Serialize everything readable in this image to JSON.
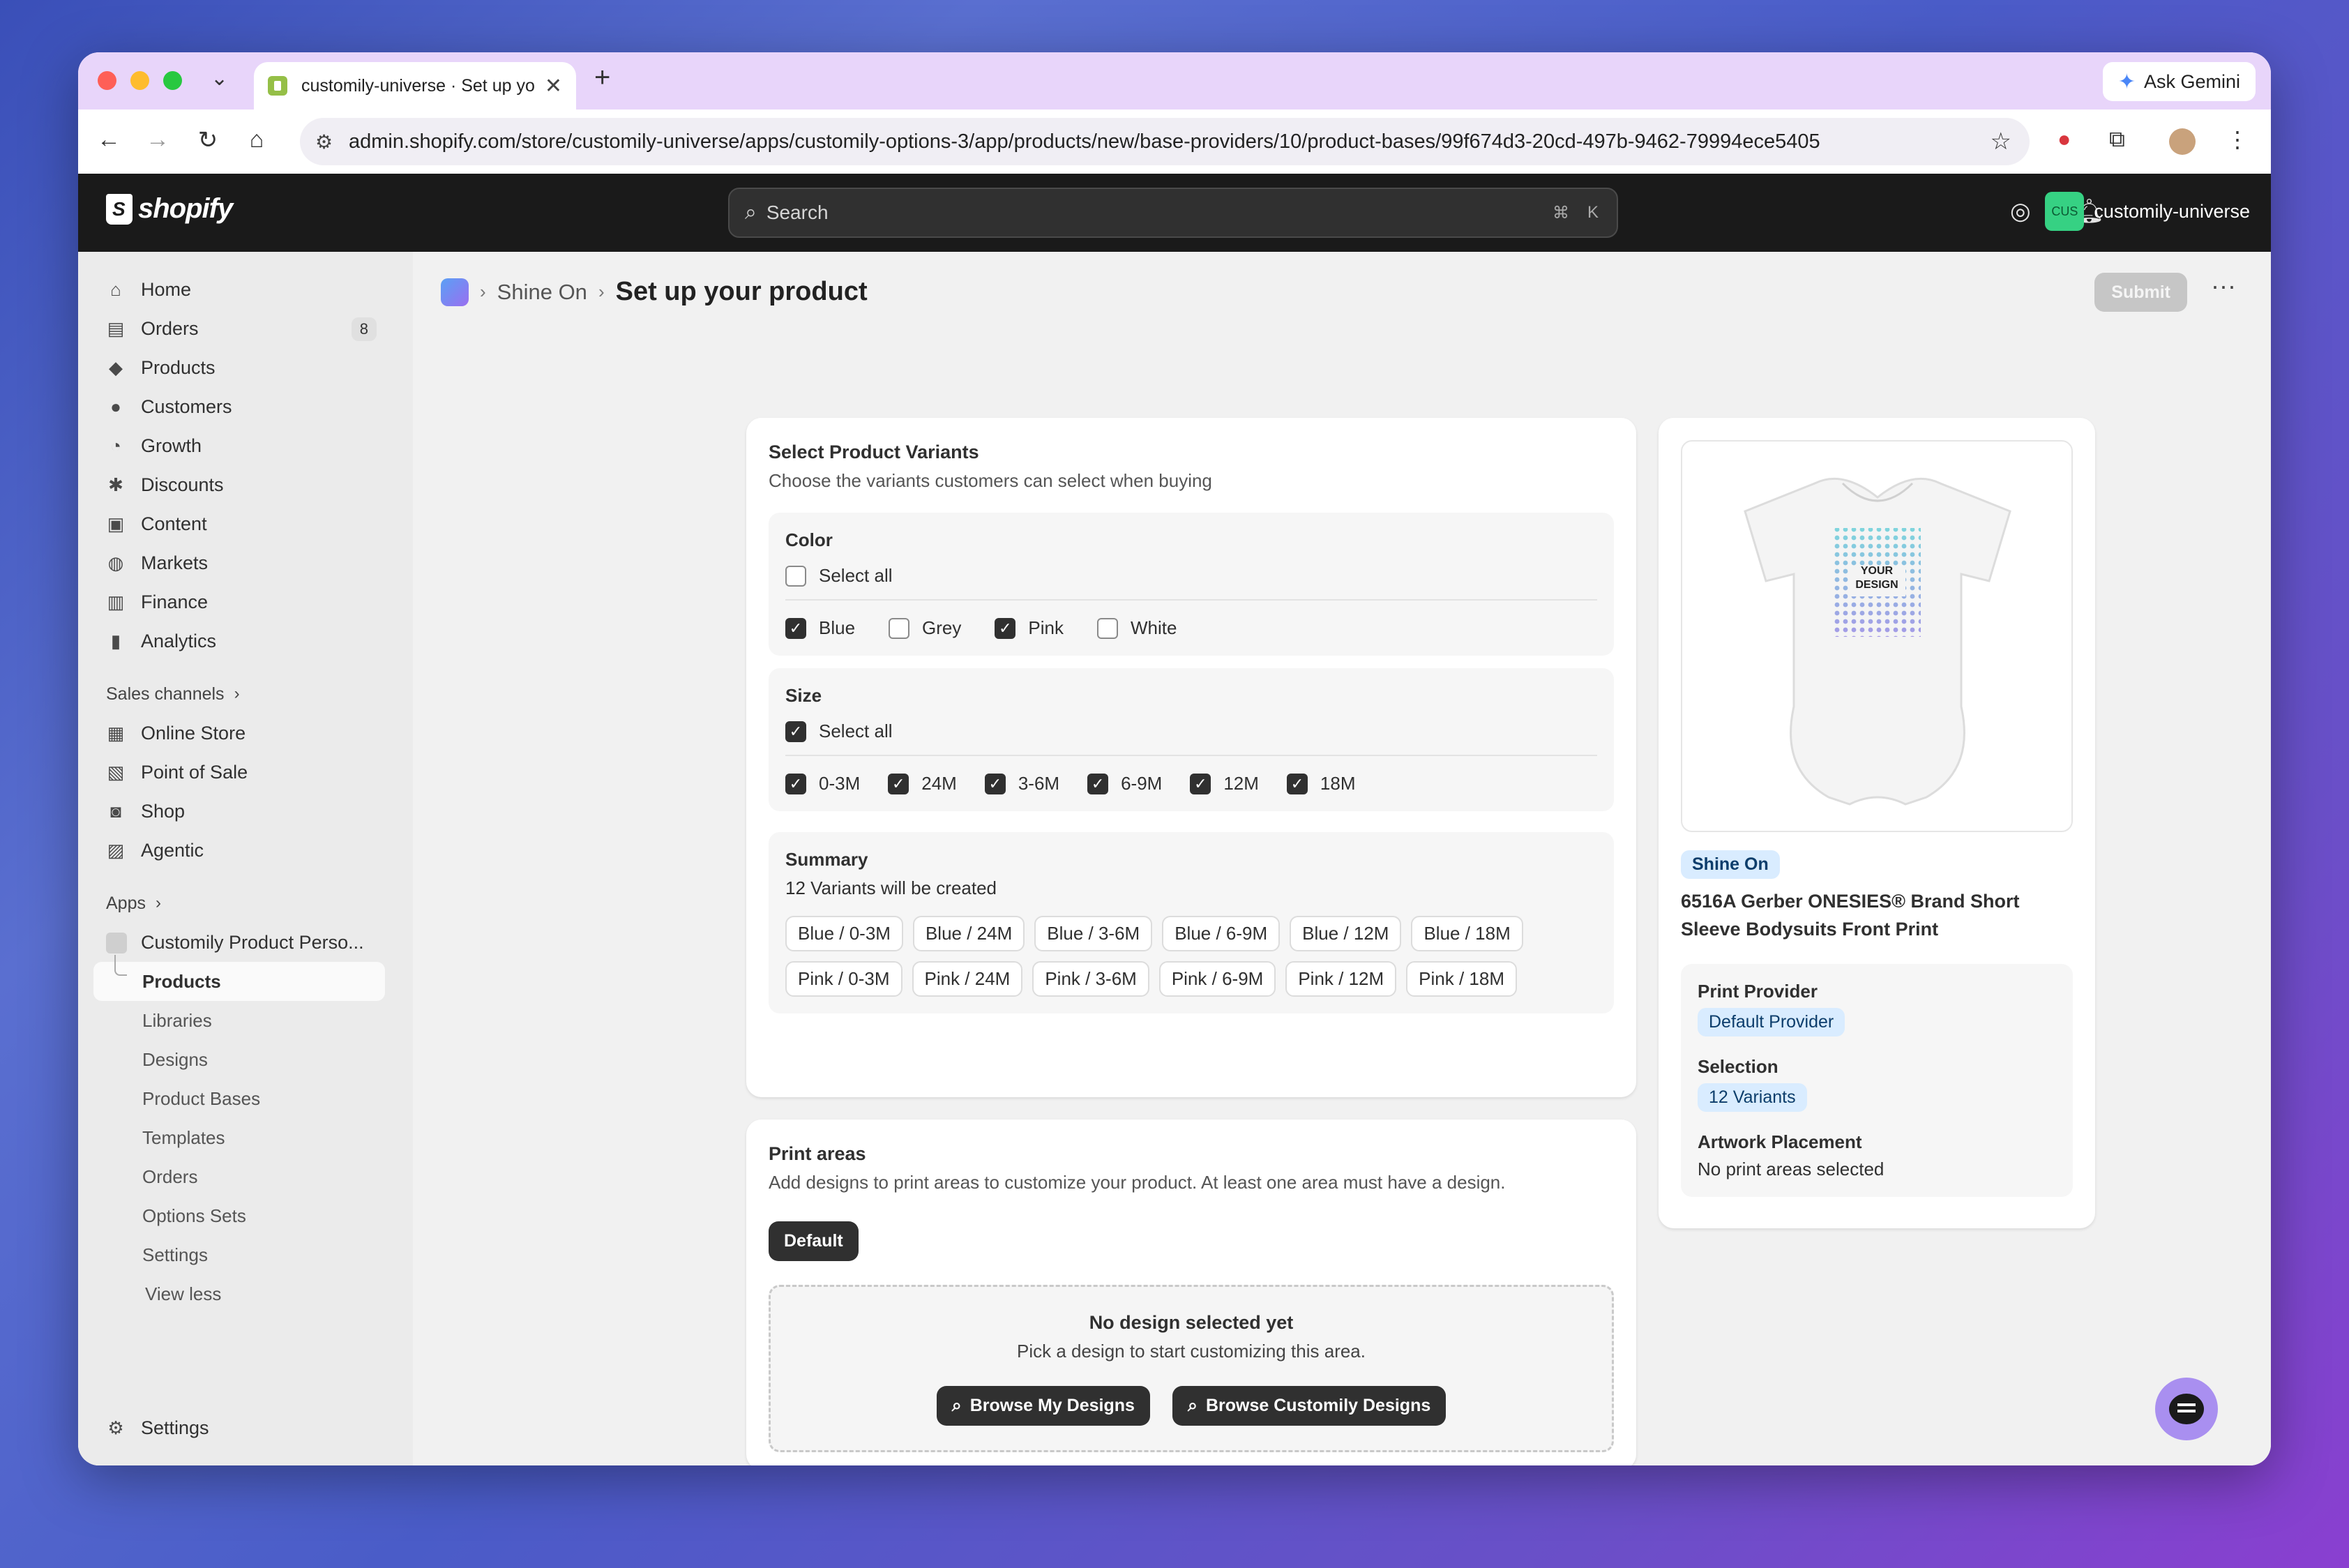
{
  "browser": {
    "tab_title": "customily-universe · Set up your product",
    "tab_dropdown": "⌄",
    "new_tab": "+",
    "ask_gemini": "Ask Gemini",
    "url": "admin.shopify.com/store/customily-universe/apps/customily-options-3/app/products/new/base-providers/10/product-bases/99f674d3-20cd-497b-9462-79994ece5405"
  },
  "topbar": {
    "logo": "shopify",
    "search_placeholder": "Search",
    "kbd_cmd": "⌘",
    "kbd_k": "K",
    "store_initials": "CUS",
    "store_name": "customily-universe"
  },
  "sidebar": {
    "items": [
      {
        "label": "Home",
        "icon": "⌂"
      },
      {
        "label": "Orders",
        "icon": "▤",
        "badge": "8"
      },
      {
        "label": "Products",
        "icon": "◆"
      },
      {
        "label": "Customers",
        "icon": "●"
      },
      {
        "label": "Growth",
        "icon": "◔"
      },
      {
        "label": "Discounts",
        "icon": "✱"
      },
      {
        "label": "Content",
        "icon": "▣"
      },
      {
        "label": "Markets",
        "icon": "◍"
      },
      {
        "label": "Finance",
        "icon": "▥"
      },
      {
        "label": "Analytics",
        "icon": "▮"
      }
    ],
    "sales_channels_label": "Sales channels",
    "channels": [
      {
        "label": "Online Store",
        "icon": "▦"
      },
      {
        "label": "Point of Sale",
        "icon": "▧"
      },
      {
        "label": "Shop",
        "icon": "◙"
      },
      {
        "label": "Agentic",
        "icon": "▨"
      }
    ],
    "apps_label": "Apps",
    "app_name": "Customily Product Perso...",
    "app_sub": [
      "Products",
      "Libraries",
      "Designs",
      "Product Bases",
      "Templates",
      "Orders",
      "Options Sets",
      "Settings"
    ],
    "view_less": "View less",
    "settings": "Settings"
  },
  "page": {
    "breadcrumb_parent": "Shine On",
    "title": "Set up your product",
    "submit": "Submit",
    "more": "···"
  },
  "variants": {
    "title": "Select Product Variants",
    "desc": "Choose the variants customers can select when buying",
    "color_title": "Color",
    "select_all": "Select all",
    "colors": [
      "Blue",
      "Grey",
      "Pink",
      "White"
    ],
    "size_title": "Size",
    "sizes": [
      "0-3M",
      "24M",
      "3-6M",
      "6-9M",
      "12M",
      "18M"
    ],
    "summary_title": "Summary",
    "summary_text": "12 Variants will be created",
    "chips": [
      "Blue / 0-3M",
      "Blue / 24M",
      "Blue / 3-6M",
      "Blue / 6-9M",
      "Blue / 12M",
      "Blue / 18M",
      "Pink / 0-3M",
      "Pink / 24M",
      "Pink / 3-6M",
      "Pink / 6-9M",
      "Pink / 12M",
      "Pink / 18M"
    ]
  },
  "print_areas": {
    "title": "Print areas",
    "desc": "Add designs to print areas to customize your product. At least one area must have a design.",
    "default_tab": "Default",
    "empty_title": "No design selected yet",
    "empty_desc": "Pick a design to start customizing this area.",
    "browse_mine": "Browse My Designs",
    "browse_customily": "Browse Customily Designs"
  },
  "product": {
    "mockup_text_1": "YOUR",
    "mockup_text_2": "DESIGN",
    "provider_badge": "Shine On",
    "name": "6516A Gerber ONESIES® Brand Short Sleeve Bodysuits Front Print",
    "print_provider_label": "Print Provider",
    "print_provider_value": "Default Provider",
    "selection_label": "Selection",
    "selection_value": "12 Variants",
    "artwork_label": "Artwork Placement",
    "artwork_value": "No print areas selected"
  }
}
